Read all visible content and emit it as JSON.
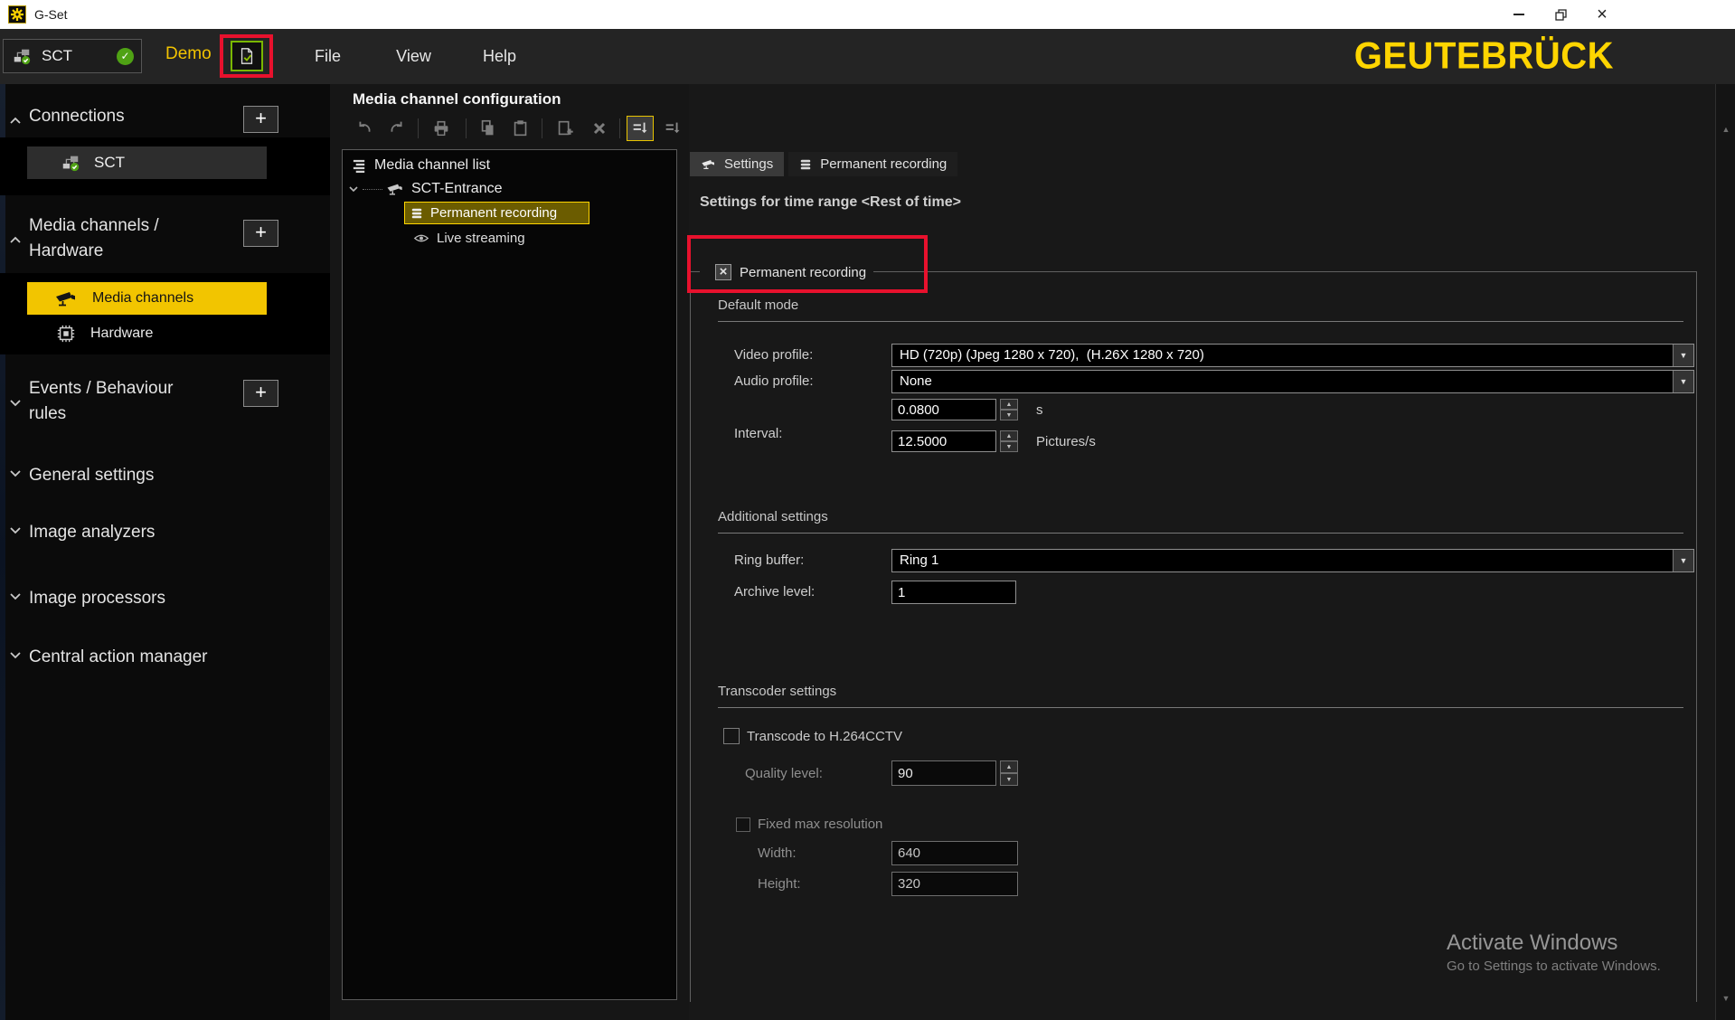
{
  "icons": {
    "check": "✓",
    "cross": "×",
    "plus": "+",
    "close": "×",
    "dropdown_arrow": "▼",
    "spin_up": "▲",
    "spin_down": "▼",
    "scroll_up": "▲",
    "scroll_down": "▼"
  },
  "colors": {
    "brand_yellow": "#ffd500",
    "selection_yellow": "#f2c500",
    "tree_selection_bg": "#6b5c00",
    "annotation_red": "#e8112d",
    "button_green_border": "#79b700",
    "status_green": "#4fa214"
  },
  "window": {
    "title": "G-Set"
  },
  "topbar": {
    "connection_name": "SCT",
    "mode_label": "Demo",
    "menus": [
      {
        "label": "File"
      },
      {
        "label": "View"
      },
      {
        "label": "Help"
      }
    ],
    "brand": "GEUTEBRÜCK"
  },
  "sidebar": {
    "sections": [
      {
        "line1": "Connections",
        "line2": "",
        "expanded": true
      },
      {
        "line1": "Media channels /",
        "line2": "Hardware",
        "expanded": true
      },
      {
        "line1": "Events / Behaviour",
        "line2": "rules",
        "expanded": false
      },
      {
        "line1": "General settings",
        "line2": "",
        "expanded": false
      },
      {
        "line1": "Image analyzers",
        "line2": "",
        "expanded": false
      },
      {
        "line1": "Image processors",
        "line2": "",
        "expanded": false
      },
      {
        "line1": "Central action manager",
        "line2": "",
        "expanded": false
      }
    ],
    "connection_item": {
      "label": "SCT"
    },
    "media_items": [
      {
        "label": "Media channels"
      },
      {
        "label": "Hardware"
      }
    ]
  },
  "middle": {
    "title": "Media channel configuration",
    "toolbar_icons": [
      "undo",
      "redo",
      "print",
      "copy",
      "paste",
      "add-item",
      "delete",
      "sort-descending-active",
      "sort-descending"
    ],
    "tree": {
      "root": "Media channel list",
      "channel": "SCT-Entrance",
      "children": [
        {
          "label": "Permanent recording"
        },
        {
          "label": "Live streaming"
        }
      ]
    }
  },
  "settings": {
    "tabs": [
      {
        "label": "Settings"
      },
      {
        "label": "Permanent recording"
      }
    ],
    "heading": "Settings for time range <Rest of time>",
    "enable_checkbox": {
      "label": "Permanent recording",
      "checked": true
    },
    "default_mode": {
      "title": "Default mode",
      "video_profile": {
        "label": "Video profile:",
        "value": "HD (720p) (Jpeg 1280 x 720),  (H.26X 1280 x 720)"
      },
      "audio_profile": {
        "label": "Audio profile:",
        "value": "None"
      },
      "interval": {
        "label": "Interval:",
        "seconds": "0.0800",
        "seconds_unit": "s",
        "rate": "12.5000",
        "rate_unit": "Pictures/s"
      }
    },
    "additional": {
      "title": "Additional settings",
      "ring_buffer": {
        "label": "Ring buffer:",
        "value": "Ring 1"
      },
      "archive_level": {
        "label": "Archive level:",
        "value": "1"
      }
    },
    "transcoder": {
      "title": "Transcoder settings",
      "transcode_checkbox": {
        "label": "Transcode to H.264CCTV",
        "checked": false
      },
      "quality_level": {
        "label": "Quality level:",
        "value": "90"
      },
      "fixed_max_checkbox": {
        "label": "Fixed max resolution",
        "checked": false
      },
      "width": {
        "label": "Width:",
        "value": "640"
      },
      "height": {
        "label": "Height:",
        "value": "320"
      }
    }
  },
  "watermark": {
    "line1": "Activate Windows",
    "line2": "Go to Settings to activate Windows."
  }
}
